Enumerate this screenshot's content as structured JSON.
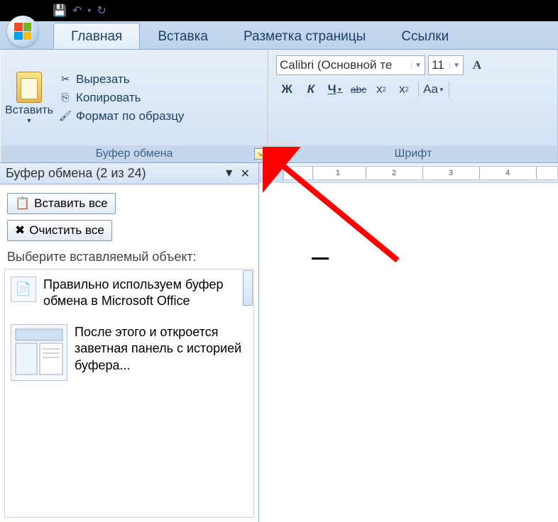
{
  "tabs": {
    "home": "Главная",
    "insert": "Вставка",
    "layout": "Разметка страницы",
    "references": "Ссылки"
  },
  "clipboard_group": {
    "label": "Буфер обмена",
    "paste": "Вставить",
    "cut": "Вырезать",
    "copy": "Копировать",
    "format_painter": "Формат по образцу"
  },
  "font_group": {
    "label": "Шрифт",
    "font_name": "Calibri (Основной те",
    "font_size": "11",
    "bold": "Ж",
    "italic": "К",
    "underline": "Ч",
    "strike": "abc",
    "subscript": "x",
    "superscript": "x",
    "changecase": "Aa"
  },
  "task_pane": {
    "title": "Буфер обмена (2 из 24)",
    "paste_all": "Вставить все",
    "clear_all": "Очистить все",
    "instruction": "Выберите вставляемый объект:",
    "items": [
      "Правильно используем буфер обмена в Microsoft Office",
      "После этого и откроется заветная панель с историей буфера..."
    ]
  },
  "ruler": {
    "marks": [
      "1",
      "2",
      "3",
      "4"
    ]
  }
}
